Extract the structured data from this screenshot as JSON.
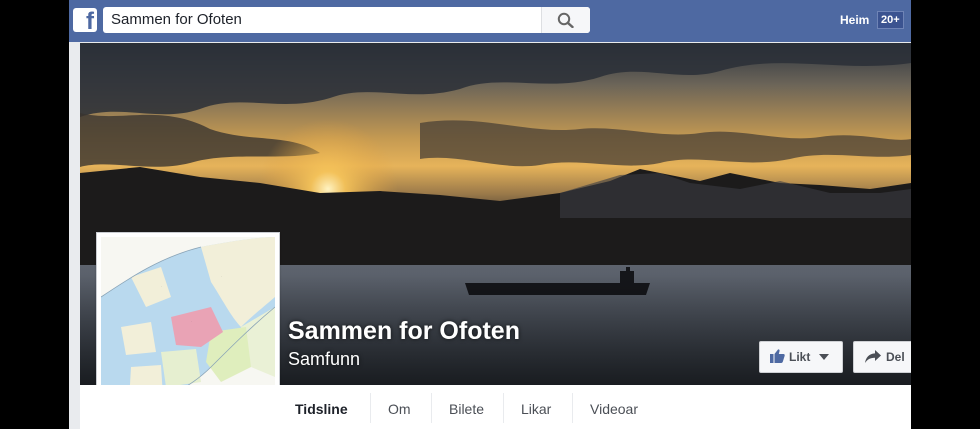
{
  "topbar": {
    "logo": "f",
    "search_value": "Sammen for Ofoten",
    "search_icon": "magnifier-icon",
    "home_label": "Heim",
    "badge": "20+"
  },
  "page": {
    "name": "Sammen for Ofoten",
    "category": "Samfunn"
  },
  "actions": {
    "like_label": "Likt",
    "share_label": "Del"
  },
  "tabs": [
    {
      "label": "Tidsline",
      "active": true
    },
    {
      "label": "Om"
    },
    {
      "label": "Bilete"
    },
    {
      "label": "Likar"
    },
    {
      "label": "Videoar"
    }
  ],
  "colors": {
    "brand": "#4e69a2",
    "badge": "#3b5390",
    "like_icon": "#4e69a2"
  }
}
